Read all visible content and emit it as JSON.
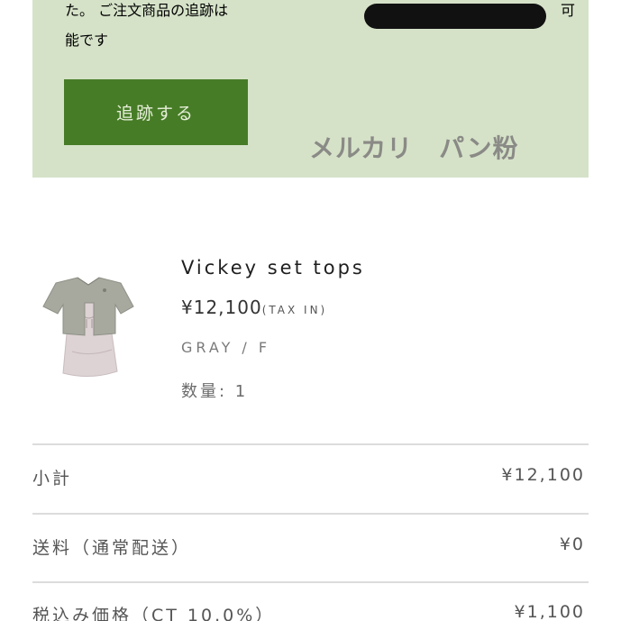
{
  "notice": {
    "line1_start": "た。 ご注文商品の追跡は",
    "line1_end": "可",
    "line2": "能です",
    "track_button_label": "追跡する"
  },
  "watermark": "メルカリ　パン粉",
  "colors": {
    "notice_bg": "#d5e2c8",
    "button_bg": "#477c27",
    "button_text": "#e6efd9"
  },
  "product": {
    "name": "Vickey set tops",
    "price": "¥12,100",
    "tax_note": "(TAX IN)",
    "variant": "GRAY / F",
    "quantity": "数量: 1"
  },
  "summary": {
    "rows": [
      {
        "label": "小計",
        "value": "¥12,100"
      },
      {
        "label": "送料（通常配送）",
        "value": "¥0"
      },
      {
        "label": "税込み価格（CT 10.0%）",
        "value": "¥1,100"
      }
    ]
  }
}
